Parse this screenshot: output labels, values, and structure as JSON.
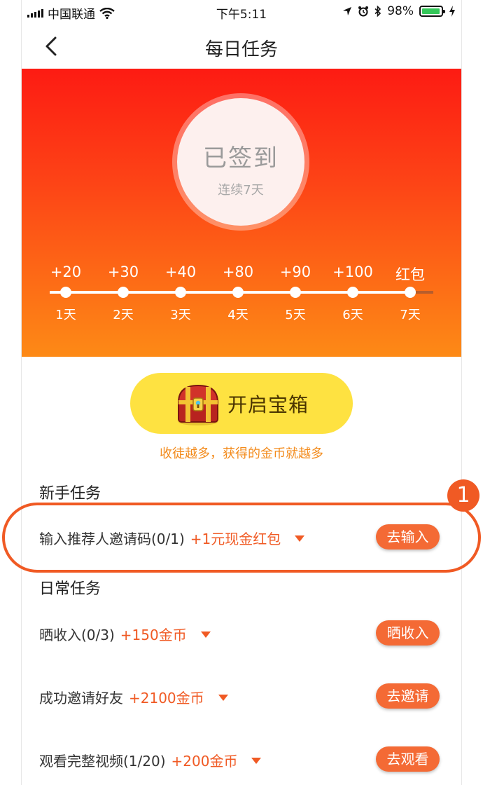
{
  "status_bar": {
    "carrier": "中国联通",
    "time": "下午5:11",
    "battery": "98%",
    "battery_level": 0.98
  },
  "nav": {
    "title": "每日任务"
  },
  "checkin": {
    "status": "已签到",
    "streak": "连续7天",
    "steps": [
      {
        "reward": "+20",
        "day": "1天"
      },
      {
        "reward": "+30",
        "day": "2天"
      },
      {
        "reward": "+40",
        "day": "3天"
      },
      {
        "reward": "+80",
        "day": "4天"
      },
      {
        "reward": "+90",
        "day": "5天"
      },
      {
        "reward": "+100",
        "day": "6天"
      },
      {
        "reward": "红包",
        "day": "7天"
      }
    ]
  },
  "chest": {
    "label": "开启宝箱",
    "hint": "收徒越多，获得的金币就越多"
  },
  "newbie": {
    "title": "新手任务",
    "tasks": [
      {
        "name": "输入推荐人邀请码(0/1)",
        "bonus": "+1元现金红包",
        "button": "去输入"
      }
    ]
  },
  "daily": {
    "title": "日常任务",
    "tasks": [
      {
        "name": "晒收入(0/3)",
        "bonus": "+150金币",
        "button": "晒收入"
      },
      {
        "name": "成功邀请好友",
        "bonus": "+2100金币",
        "button": "去邀请"
      },
      {
        "name": "观看完整视频(1/20)",
        "bonus": "+200金币",
        "button": "去观看"
      }
    ]
  },
  "annotation": {
    "badge": "1"
  },
  "colors": {
    "accent": "#f05a24",
    "banner_top": "#fd1b13",
    "banner_bottom": "#fd8a16",
    "chest_button": "#fee241"
  }
}
